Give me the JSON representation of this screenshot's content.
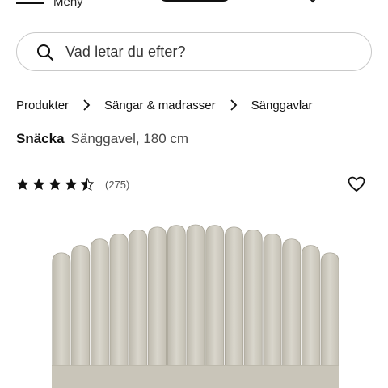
{
  "header": {
    "menu_label": "Meny",
    "logo_text": "mio"
  },
  "search": {
    "placeholder": "Vad letar du efter?"
  },
  "breadcrumb": {
    "items": [
      "Produkter",
      "Sängar & madrasser",
      "Sänggavlar"
    ]
  },
  "product": {
    "name": "Snäcka",
    "description": "Sänggavel, 180 cm",
    "rating": 4.5,
    "rating_max": 5,
    "review_count": "(275)"
  },
  "colors": {
    "text": "#111111",
    "muted": "#484848",
    "border": "#c9c9c9",
    "headboard": "#cfcbbf"
  }
}
